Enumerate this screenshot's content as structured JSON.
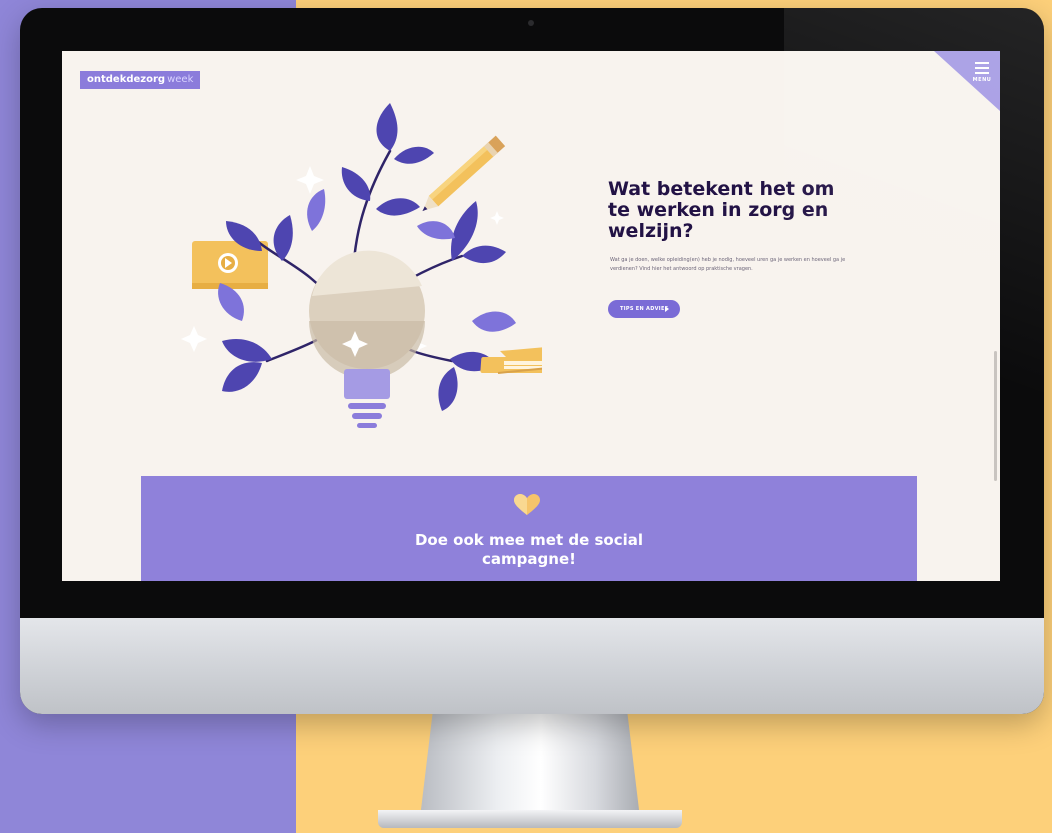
{
  "site": {
    "logo": {
      "bold": "ontdekdezorg",
      "light": "week"
    },
    "menu": {
      "label": "MENU"
    }
  },
  "hero": {
    "title": "Wat betekent het om te werken in zorg en welzijn?",
    "intro": "Wat ga je doen, welke opleiding(en) heb je nodig, hoeveel uren ga je werken en hoeveel ga je verdienen? Vind hier het antwoord op praktische vragen.",
    "cta": "TIPS EN ADVIES"
  },
  "campaign": {
    "icon": "heart-icon",
    "title_line1": "Doe ook mee met de social",
    "title_line2": "campagne!"
  },
  "colors": {
    "accent": "#8B7CDB",
    "heading": "#221245",
    "screen_bg": "#F8F3EE",
    "brand_yellow": "#FDD07A"
  }
}
